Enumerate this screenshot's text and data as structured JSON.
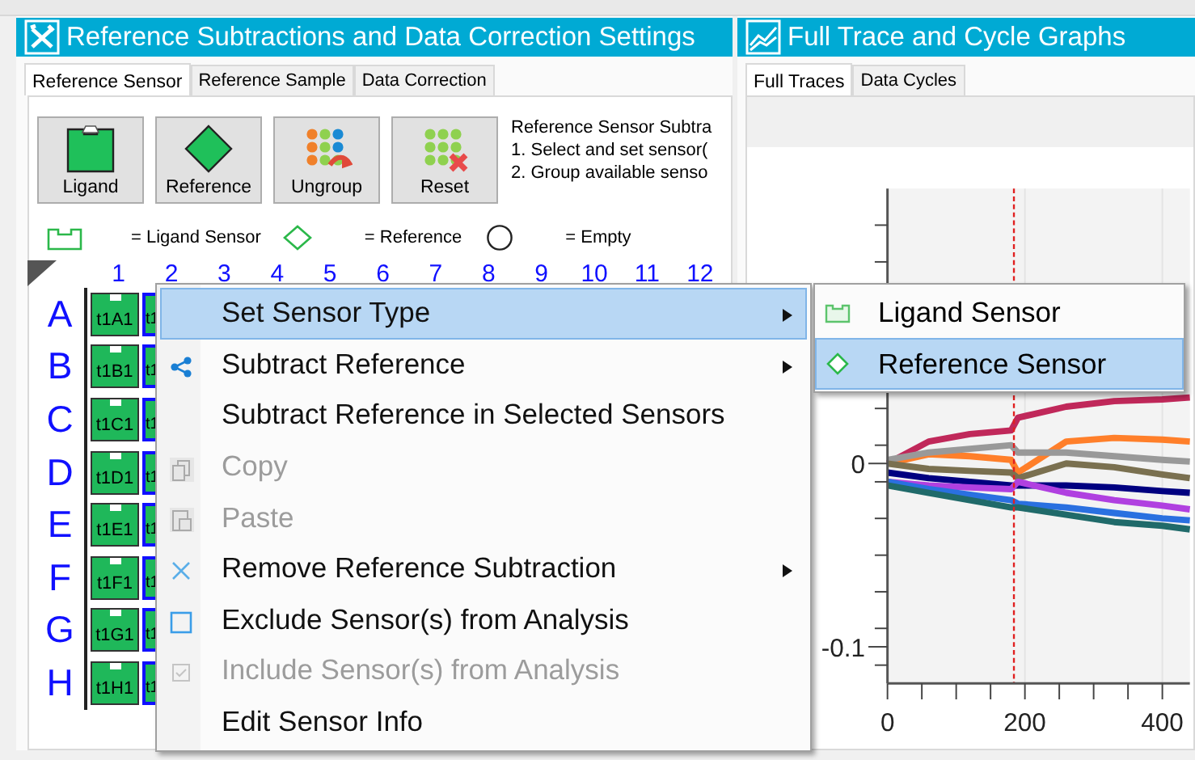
{
  "left_panel": {
    "title": "Reference Subtractions and Data Correction Settings",
    "tabs": [
      {
        "label": "Reference Sensor",
        "selected": true
      },
      {
        "label": "Reference Sample",
        "selected": false
      },
      {
        "label": "Data Correction",
        "selected": false
      }
    ],
    "tools": [
      {
        "label": "Ligand",
        "kind": "ligand"
      },
      {
        "label": "Reference",
        "kind": "reference"
      },
      {
        "label": "Ungroup",
        "kind": "ungroup"
      },
      {
        "label": "Reset",
        "kind": "reset"
      }
    ],
    "instructions": [
      "Reference Sensor Subtra",
      "1.  Select and set sensor(",
      "2.  Group available senso"
    ],
    "legend": [
      {
        "kind": "ligand",
        "label": "= Ligand Sensor"
      },
      {
        "kind": "reference",
        "label": "= Reference"
      },
      {
        "kind": "empty",
        "label": "= Empty"
      }
    ],
    "plate": {
      "columns": [
        "1",
        "2",
        "3",
        "4",
        "5",
        "6",
        "7",
        "8",
        "9",
        "10",
        "11",
        "12"
      ],
      "rows": [
        {
          "label": "A",
          "cells": [
            {
              "text": "t1A1",
              "selected": false
            },
            {
              "text": "t1",
              "selected": true
            }
          ]
        },
        {
          "label": "B",
          "cells": [
            {
              "text": "t1B1",
              "selected": false
            },
            {
              "text": "t1",
              "selected": true
            }
          ]
        },
        {
          "label": "C",
          "cells": [
            {
              "text": "t1C1",
              "selected": false
            },
            {
              "text": "t1",
              "selected": true
            }
          ]
        },
        {
          "label": "D",
          "cells": [
            {
              "text": "t1D1",
              "selected": false
            },
            {
              "text": "t1",
              "selected": true
            }
          ]
        },
        {
          "label": "E",
          "cells": [
            {
              "text": "t1E1",
              "selected": false
            },
            {
              "text": "t1",
              "selected": true
            }
          ]
        },
        {
          "label": "F",
          "cells": [
            {
              "text": "t1F1",
              "selected": false
            },
            {
              "text": "t1",
              "selected": true
            }
          ]
        },
        {
          "label": "G",
          "cells": [
            {
              "text": "t1G1",
              "selected": false
            },
            {
              "text": "t1",
              "selected": true
            }
          ]
        },
        {
          "label": "H",
          "cells": [
            {
              "text": "t1H1",
              "selected": false
            },
            {
              "text": "t1",
              "selected": true
            }
          ]
        }
      ]
    }
  },
  "right_panel": {
    "title": "Full Trace and Cycle Graphs",
    "tabs": [
      {
        "label": "Full Traces",
        "selected": true
      },
      {
        "label": "Data Cycles",
        "selected": false
      }
    ],
    "chart_data": {
      "type": "line",
      "x": [
        0,
        60,
        120,
        180,
        190,
        260,
        330,
        400,
        440
      ],
      "xlim": [
        0,
        440
      ],
      "ylim": [
        -0.12,
        0.15
      ],
      "xticks": [
        0,
        200,
        400
      ],
      "yticks": [
        -0.1,
        0
      ],
      "ref_lines": [
        {
          "axis": "x",
          "value": 184
        }
      ],
      "series": [
        {
          "color": "#c0285a",
          "values": [
            0,
            0.012,
            0.016,
            0.018,
            0.025,
            0.031,
            0.034,
            0.035,
            0.036
          ]
        },
        {
          "color": "#ff7f2a",
          "values": [
            0,
            0.005,
            0.004,
            0.002,
            -0.005,
            0.012,
            0.014,
            0.013,
            0.012
          ]
        },
        {
          "color": "#999999",
          "values": [
            0.002,
            0.006,
            0.008,
            0.01,
            0.006,
            0.006,
            0.004,
            0.002,
            0.001
          ]
        },
        {
          "color": "#7a7050",
          "values": [
            0,
            -0.003,
            -0.004,
            -0.005,
            -0.008,
            0,
            -0.002,
            -0.006,
            -0.008
          ]
        },
        {
          "color": "#000080",
          "values": [
            -0.005,
            -0.008,
            -0.01,
            -0.012,
            -0.012,
            -0.012,
            -0.013,
            -0.015,
            -0.016
          ]
        },
        {
          "color": "#b040e0",
          "values": [
            -0.01,
            -0.012,
            -0.013,
            -0.014,
            -0.01,
            -0.016,
            -0.02,
            -0.023,
            -0.025
          ]
        },
        {
          "color": "#2a70e0",
          "values": [
            -0.01,
            -0.014,
            -0.017,
            -0.02,
            -0.022,
            -0.024,
            -0.027,
            -0.03,
            -0.031
          ]
        },
        {
          "color": "#206a6a",
          "values": [
            -0.012,
            -0.016,
            -0.02,
            -0.024,
            -0.024,
            -0.028,
            -0.032,
            -0.034,
            -0.036
          ]
        }
      ]
    }
  },
  "context_menu": {
    "items": [
      {
        "label": "Set Sensor Type",
        "selected": true,
        "disabled": false,
        "submenu": true
      },
      {
        "label": "Subtract Reference",
        "selected": false,
        "disabled": false,
        "submenu": true
      },
      {
        "label": "Subtract Reference in Selected Sensors",
        "selected": false,
        "disabled": false,
        "submenu": false
      },
      {
        "label": "Copy",
        "selected": false,
        "disabled": true,
        "submenu": false
      },
      {
        "label": "Paste",
        "selected": false,
        "disabled": true,
        "submenu": false
      },
      {
        "label": "Remove Reference Subtraction",
        "selected": false,
        "disabled": false,
        "submenu": true
      },
      {
        "label": "Exclude Sensor(s) from Analysis",
        "selected": false,
        "disabled": false,
        "submenu": false
      },
      {
        "label": "Include Sensor(s) from Analysis",
        "selected": false,
        "disabled": true,
        "submenu": false
      },
      {
        "label": "Edit Sensor Info",
        "selected": false,
        "disabled": false,
        "submenu": false
      }
    ]
  },
  "submenu": {
    "items": [
      {
        "label": "Ligand Sensor",
        "selected": false
      },
      {
        "label": "Reference Sensor",
        "selected": true
      }
    ]
  }
}
